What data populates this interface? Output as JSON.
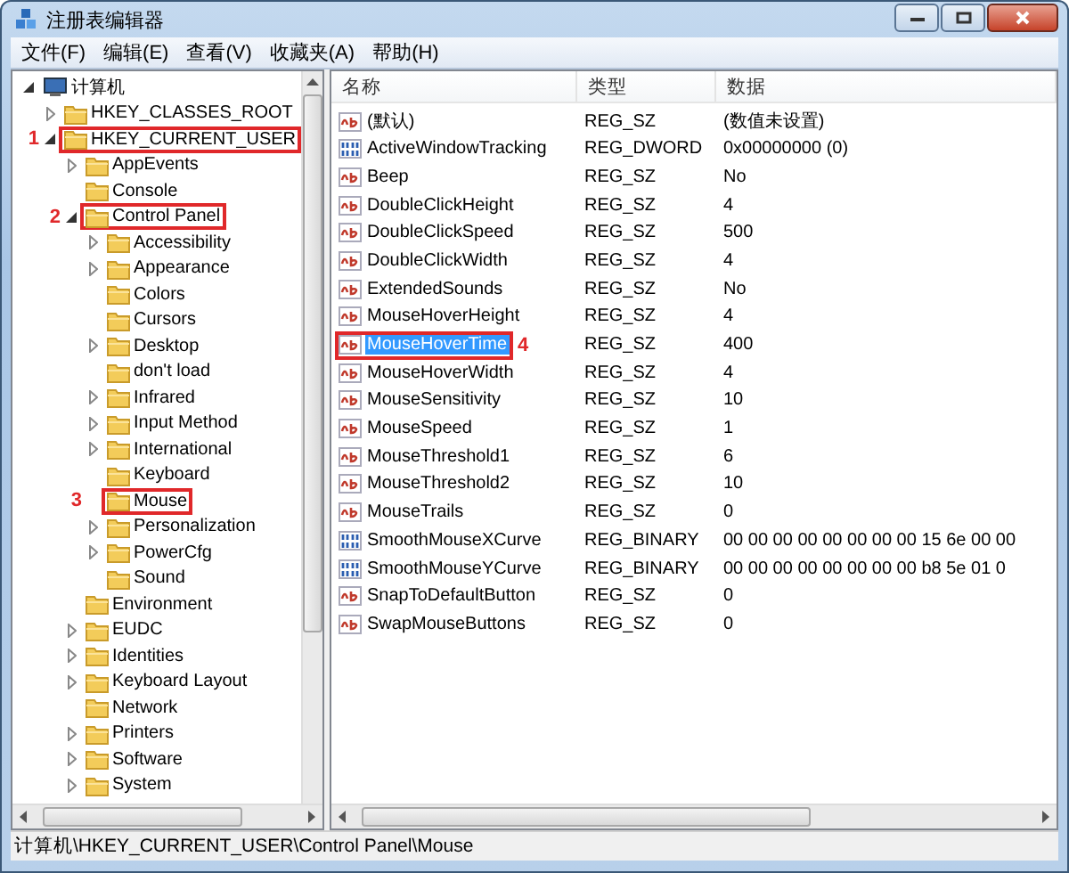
{
  "window": {
    "title": "注册表编辑器"
  },
  "menu": [
    "文件(F)",
    "编辑(E)",
    "查看(V)",
    "收藏夹(A)",
    "帮助(H)"
  ],
  "tree": [
    {
      "label": "计算机",
      "kind": "computer",
      "expanded": true,
      "children": [
        {
          "label": "HKEY_CLASSES_ROOT",
          "kind": "branch",
          "expanded": false
        },
        {
          "label": "HKEY_CURRENT_USER",
          "kind": "branch",
          "expanded": true,
          "annotation": "1",
          "children": [
            {
              "label": "AppEvents",
              "kind": "branch",
              "expanded": false
            },
            {
              "label": "Console",
              "kind": "leaf"
            },
            {
              "label": "Control Panel",
              "kind": "branch",
              "expanded": true,
              "annotation": "2",
              "children": [
                {
                  "label": "Accessibility",
                  "kind": "branch",
                  "expanded": false
                },
                {
                  "label": "Appearance",
                  "kind": "branch",
                  "expanded": false
                },
                {
                  "label": "Colors",
                  "kind": "leaf"
                },
                {
                  "label": "Cursors",
                  "kind": "leaf"
                },
                {
                  "label": "Desktop",
                  "kind": "branch",
                  "expanded": false
                },
                {
                  "label": "don't load",
                  "kind": "leaf"
                },
                {
                  "label": "Infrared",
                  "kind": "branch",
                  "expanded": false
                },
                {
                  "label": "Input Method",
                  "kind": "branch",
                  "expanded": false
                },
                {
                  "label": "International",
                  "kind": "branch",
                  "expanded": false
                },
                {
                  "label": "Keyboard",
                  "kind": "leaf"
                },
                {
                  "label": "Mouse",
                  "kind": "leaf",
                  "annotation": "3"
                },
                {
                  "label": "Personalization",
                  "kind": "branch",
                  "expanded": false
                },
                {
                  "label": "PowerCfg",
                  "kind": "branch",
                  "expanded": false
                },
                {
                  "label": "Sound",
                  "kind": "leaf"
                }
              ]
            },
            {
              "label": "Environment",
              "kind": "leaf"
            },
            {
              "label": "EUDC",
              "kind": "branch",
              "expanded": false
            },
            {
              "label": "Identities",
              "kind": "branch",
              "expanded": false
            },
            {
              "label": "Keyboard Layout",
              "kind": "branch",
              "expanded": false
            },
            {
              "label": "Network",
              "kind": "leaf"
            },
            {
              "label": "Printers",
              "kind": "branch",
              "expanded": false
            },
            {
              "label": "Software",
              "kind": "branch",
              "expanded": false
            },
            {
              "label": "System",
              "kind": "branch",
              "expanded": false
            }
          ]
        }
      ]
    }
  ],
  "columns": [
    "名称",
    "类型",
    "数据"
  ],
  "values": [
    {
      "name": "(默认)",
      "kind": "string",
      "type": "REG_SZ",
      "data": "(数值未设置)",
      "selected": false
    },
    {
      "name": "ActiveWindowTracking",
      "kind": "binary",
      "type": "REG_DWORD",
      "data": "0x00000000 (0)",
      "selected": false
    },
    {
      "name": "Beep",
      "kind": "string",
      "type": "REG_SZ",
      "data": "No",
      "selected": false
    },
    {
      "name": "DoubleClickHeight",
      "kind": "string",
      "type": "REG_SZ",
      "data": "4",
      "selected": false
    },
    {
      "name": "DoubleClickSpeed",
      "kind": "string",
      "type": "REG_SZ",
      "data": "500",
      "selected": false
    },
    {
      "name": "DoubleClickWidth",
      "kind": "string",
      "type": "REG_SZ",
      "data": "4",
      "selected": false
    },
    {
      "name": "ExtendedSounds",
      "kind": "string",
      "type": "REG_SZ",
      "data": "No",
      "selected": false
    },
    {
      "name": "MouseHoverHeight",
      "kind": "string",
      "type": "REG_SZ",
      "data": "4",
      "selected": false
    },
    {
      "name": "MouseHoverTime",
      "kind": "string",
      "type": "REG_SZ",
      "data": "400",
      "selected": true,
      "annotation": "4"
    },
    {
      "name": "MouseHoverWidth",
      "kind": "string",
      "type": "REG_SZ",
      "data": "4",
      "selected": false
    },
    {
      "name": "MouseSensitivity",
      "kind": "string",
      "type": "REG_SZ",
      "data": "10",
      "selected": false
    },
    {
      "name": "MouseSpeed",
      "kind": "string",
      "type": "REG_SZ",
      "data": "1",
      "selected": false
    },
    {
      "name": "MouseThreshold1",
      "kind": "string",
      "type": "REG_SZ",
      "data": "6",
      "selected": false
    },
    {
      "name": "MouseThreshold2",
      "kind": "string",
      "type": "REG_SZ",
      "data": "10",
      "selected": false
    },
    {
      "name": "MouseTrails",
      "kind": "string",
      "type": "REG_SZ",
      "data": "0",
      "selected": false
    },
    {
      "name": "SmoothMouseXCurve",
      "kind": "binary",
      "type": "REG_BINARY",
      "data": "00 00 00 00 00 00 00 00 15 6e 00 00",
      "selected": false
    },
    {
      "name": "SmoothMouseYCurve",
      "kind": "binary",
      "type": "REG_BINARY",
      "data": "00 00 00 00 00 00 00 00 b8 5e 01 0",
      "selected": false
    },
    {
      "name": "SnapToDefaultButton",
      "kind": "string",
      "type": "REG_SZ",
      "data": "0",
      "selected": false
    },
    {
      "name": "SwapMouseButtons",
      "kind": "string",
      "type": "REG_SZ",
      "data": "0",
      "selected": false
    }
  ],
  "status_bar": "计算机\\HKEY_CURRENT_USER\\Control Panel\\Mouse"
}
